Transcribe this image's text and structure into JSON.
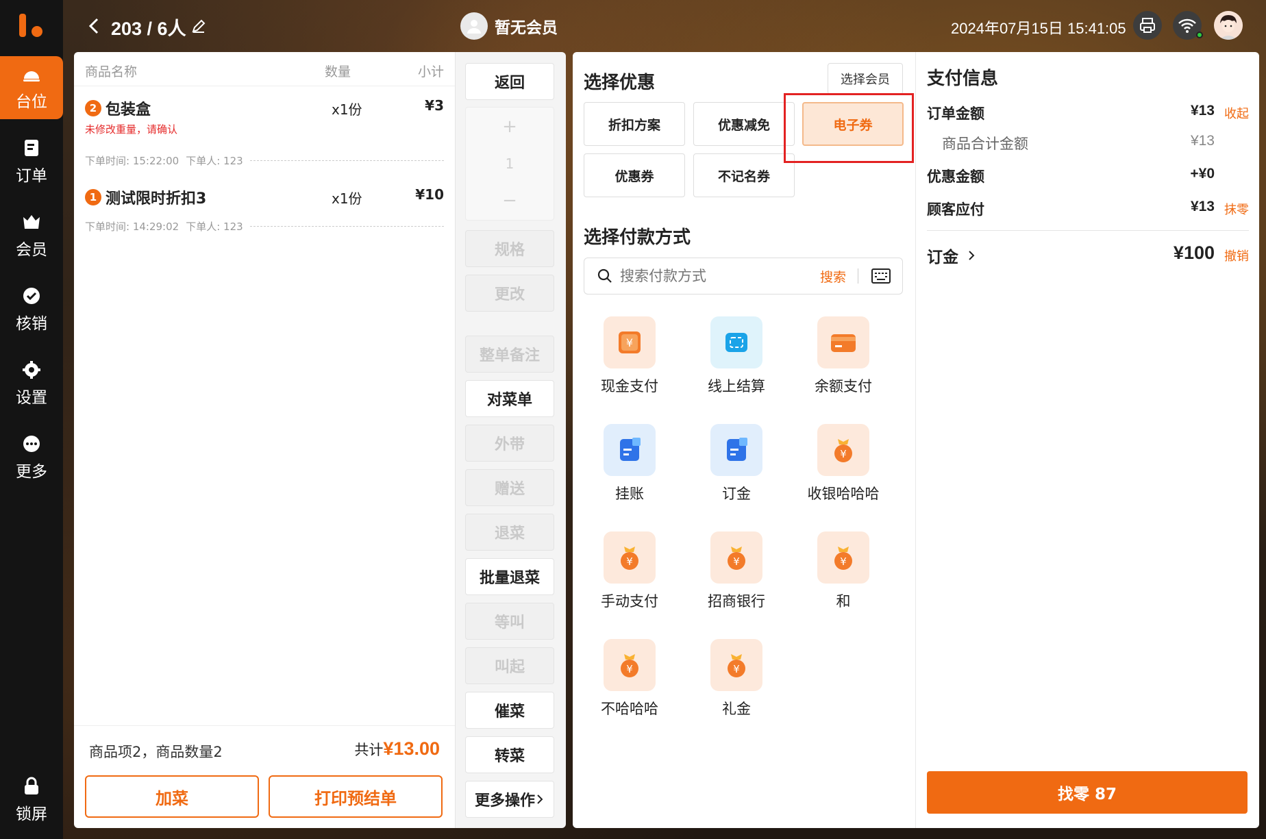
{
  "colors": {
    "accent": "#f06a12",
    "sidebar": "#141414",
    "warn": "#e52b2b",
    "highlight": "#e32222"
  },
  "sidebar": {
    "items": [
      {
        "label": "台位",
        "icon": "table-bell-icon"
      },
      {
        "label": "订单",
        "icon": "order-icon"
      },
      {
        "label": "会员",
        "icon": "member-crown-icon"
      },
      {
        "label": "核销",
        "icon": "verify-check-icon"
      },
      {
        "label": "设置",
        "icon": "gear-icon"
      },
      {
        "label": "更多",
        "icon": "more-dots-icon"
      },
      {
        "label": "锁屏",
        "icon": "lock-icon"
      }
    ]
  },
  "topbar": {
    "table": "203 / 6人",
    "member": "暂无会员",
    "datetime": "2024年07月15日 15:41:05"
  },
  "order": {
    "headers": {
      "name": "商品名称",
      "qty": "数量",
      "subtotal": "小计"
    },
    "items": [
      {
        "index": "2",
        "name": "包装盒",
        "qty": "x1份",
        "subtotal": "¥3",
        "warning": "未修改重量，请确认",
        "time": "下单时间: 15:22:00",
        "user": "下单人: 123"
      },
      {
        "index": "1",
        "name": "测试限时折扣3",
        "qty": "x1份",
        "subtotal": "¥10",
        "warning": "",
        "time": "下单时间: 14:29:02",
        "user": "下单人: 123"
      }
    ],
    "summary": "商品项2，商品数量2",
    "total_label": "共计",
    "total": "¥13.00",
    "add_button": "加菜",
    "print_button": "打印预结单"
  },
  "actions": {
    "back": "返回",
    "stepper_plus": "+",
    "stepper_value": "1",
    "stepper_minus": "−",
    "spec": "规格",
    "modify": "更改",
    "note": "整单备注",
    "check": "对菜单",
    "takeaway": "外带",
    "gift": "赠送",
    "refund": "退菜",
    "batch_refund": "批量退菜",
    "wait": "等叫",
    "call": "叫起",
    "urge": "催菜",
    "transfer": "转菜",
    "more": "更多操作"
  },
  "discount": {
    "title": "选择优惠",
    "select_member": "选择会员",
    "options": [
      "折扣方案",
      "优惠减免",
      "电子券",
      "优惠券",
      "不记名券"
    ],
    "selected": "电子券"
  },
  "payment_methods": {
    "title": "选择付款方式",
    "search_placeholder": "搜索付款方式",
    "search_button": "搜索",
    "methods": [
      {
        "label": "现金支付",
        "icon": "cash-yuan-icon"
      },
      {
        "label": "线上结算",
        "icon": "online-wallet-icon"
      },
      {
        "label": "余额支付",
        "icon": "balance-card-icon"
      },
      {
        "label": "挂账",
        "icon": "credit-note-icon"
      },
      {
        "label": "订金",
        "icon": "deposit-note-icon"
      },
      {
        "label": "收银哈哈哈",
        "icon": "money-bag-icon"
      },
      {
        "label": "手动支付",
        "icon": "money-bag-icon"
      },
      {
        "label": "招商银行",
        "icon": "money-bag-icon"
      },
      {
        "label": "和",
        "icon": "money-bag-icon"
      },
      {
        "label": "不哈哈哈",
        "icon": "money-bag-icon"
      },
      {
        "label": "礼金",
        "icon": "money-bag-icon"
      }
    ]
  },
  "pay_info": {
    "title": "支付信息",
    "order_amount_label": "订单金额",
    "order_amount": "¥13",
    "collapse": "收起",
    "goods_total_label": "商品合计金额",
    "goods_total": "¥13",
    "discount_label": "优惠金额",
    "discount": "+¥0",
    "payable_label": "顾客应付",
    "payable": "¥13",
    "round_off": "抹零",
    "deposit_label": "订金",
    "deposit": "¥100",
    "revoke": "撤销",
    "change_button": "找零 87"
  }
}
